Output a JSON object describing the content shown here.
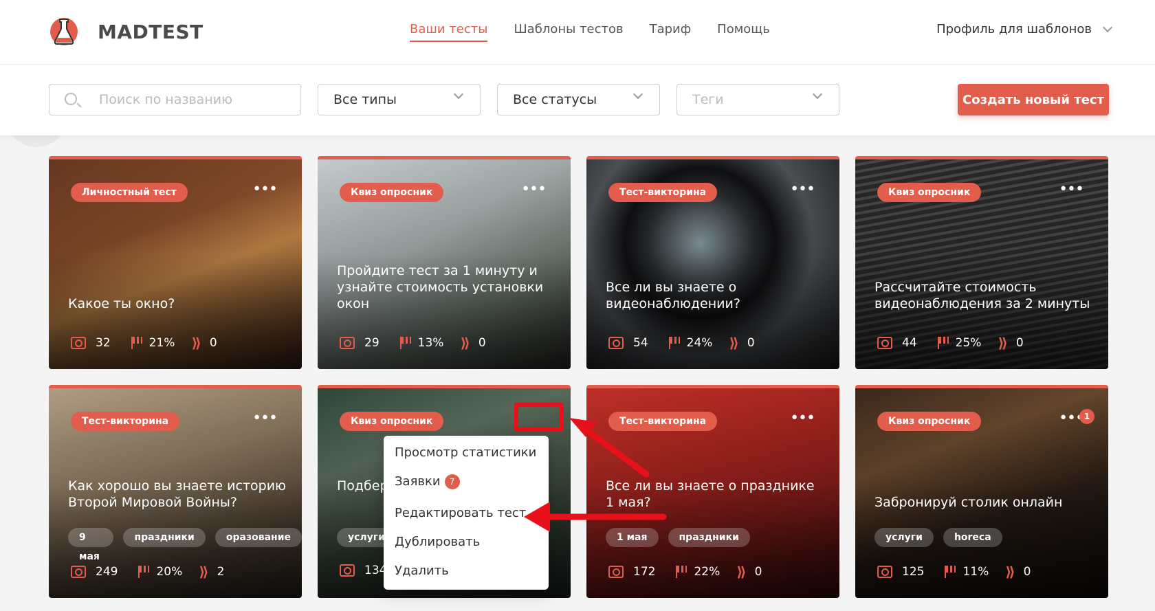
{
  "brand": {
    "name": "MADTEST"
  },
  "nav": [
    "Ваши тесты",
    "Шаблоны тестов",
    "Тариф",
    "Помощь"
  ],
  "profile": {
    "label": "Профиль для шаблонов"
  },
  "filters": {
    "search_placeholder": "Поиск по названию",
    "type": "Все типы",
    "status": "Все статусы",
    "tags_placeholder": "Теги"
  },
  "create_button": "Создать новый тест",
  "cards": [
    {
      "badge": "Личностный тест",
      "title": "Какое ты окно?",
      "views": "32",
      "conv": "21%",
      "leads": "0",
      "tags": []
    },
    {
      "badge": "Квиз опросник",
      "title": "Пройдите тест за 1 минуту и узнайте стоимость установки окон",
      "views": "29",
      "conv": "13%",
      "leads": "0",
      "tags": []
    },
    {
      "badge": "Тест-викторина",
      "title": "Все ли вы знаете о видеонаблюдении?",
      "views": "54",
      "conv": "24%",
      "leads": "0",
      "tags": []
    },
    {
      "badge": "Квиз опросник",
      "title": "Рассчитайте стоимость видеонаблюдения за 2 минуты",
      "views": "44",
      "conv": "25%",
      "leads": "0",
      "tags": []
    },
    {
      "badge": "Тест-викторина",
      "title": "Как хорошо вы знаете историю Второй Мировой Войны?",
      "views": "249",
      "conv": "20%",
      "leads": "2",
      "tags": [
        "9 мая",
        "праздники",
        "оразование"
      ]
    },
    {
      "badge": "Квиз опросник",
      "title": "Подбер отдыха",
      "views": "134",
      "conv": "",
      "leads": "",
      "tags": [
        "услуги"
      ]
    },
    {
      "badge": "Тест-викторина",
      "title": "Все ли вы знаете о празднике 1 мая?",
      "views": "172",
      "conv": "22%",
      "leads": "0",
      "tags": [
        "1 мая",
        "праздники"
      ]
    },
    {
      "badge": "Квиз опросник",
      "title": "Забронируй столик онлайн",
      "views": "125",
      "conv": "11%",
      "leads": "0",
      "tags": [
        "услуги",
        "horeca"
      ],
      "notification": "1"
    }
  ],
  "context_menu": {
    "items": [
      "Просмотр статистики",
      "Заявки",
      "Редактировать тест",
      "Дублировать",
      "Удалить"
    ],
    "requests_count": "7"
  },
  "accent_color": "#e35d4c"
}
